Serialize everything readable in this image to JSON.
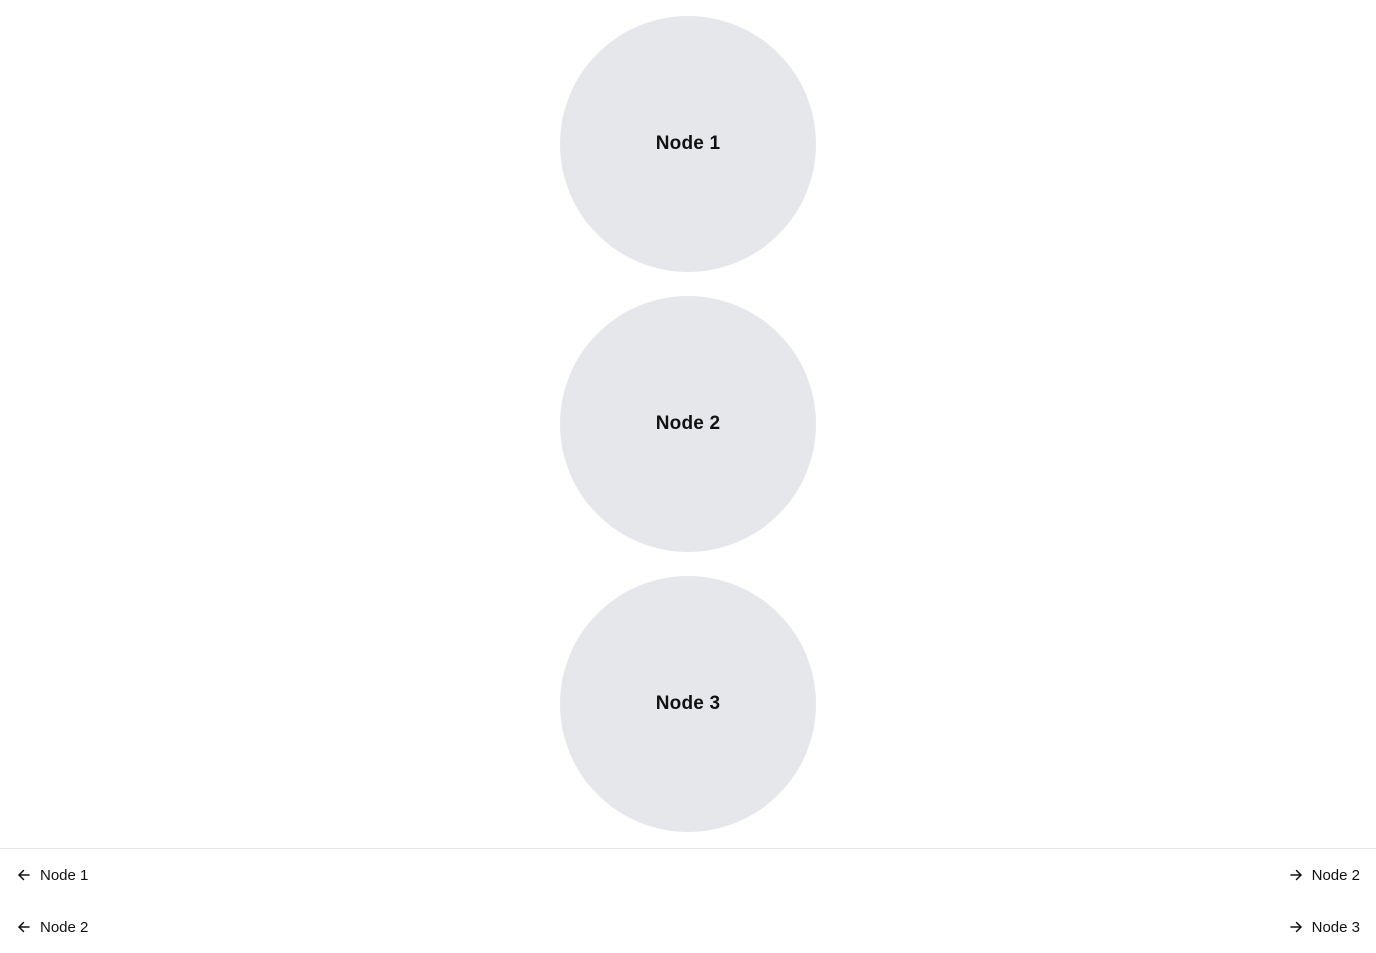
{
  "nodes": [
    {
      "label": "Node 1"
    },
    {
      "label": "Node 2"
    },
    {
      "label": "Node 3"
    }
  ],
  "edges": [
    {
      "from": "Node 1",
      "to": "Node 2",
      "from_icon": "arrow-left-icon",
      "to_icon": "arrow-right-icon"
    },
    {
      "from": "Node 2",
      "to": "Node 3",
      "from_icon": "arrow-left-icon",
      "to_icon": "arrow-right-icon"
    }
  ],
  "colors": {
    "node_fill": "#e5e7eb",
    "text": "#111111",
    "divider": "#e5e7eb",
    "background": "#ffffff"
  }
}
